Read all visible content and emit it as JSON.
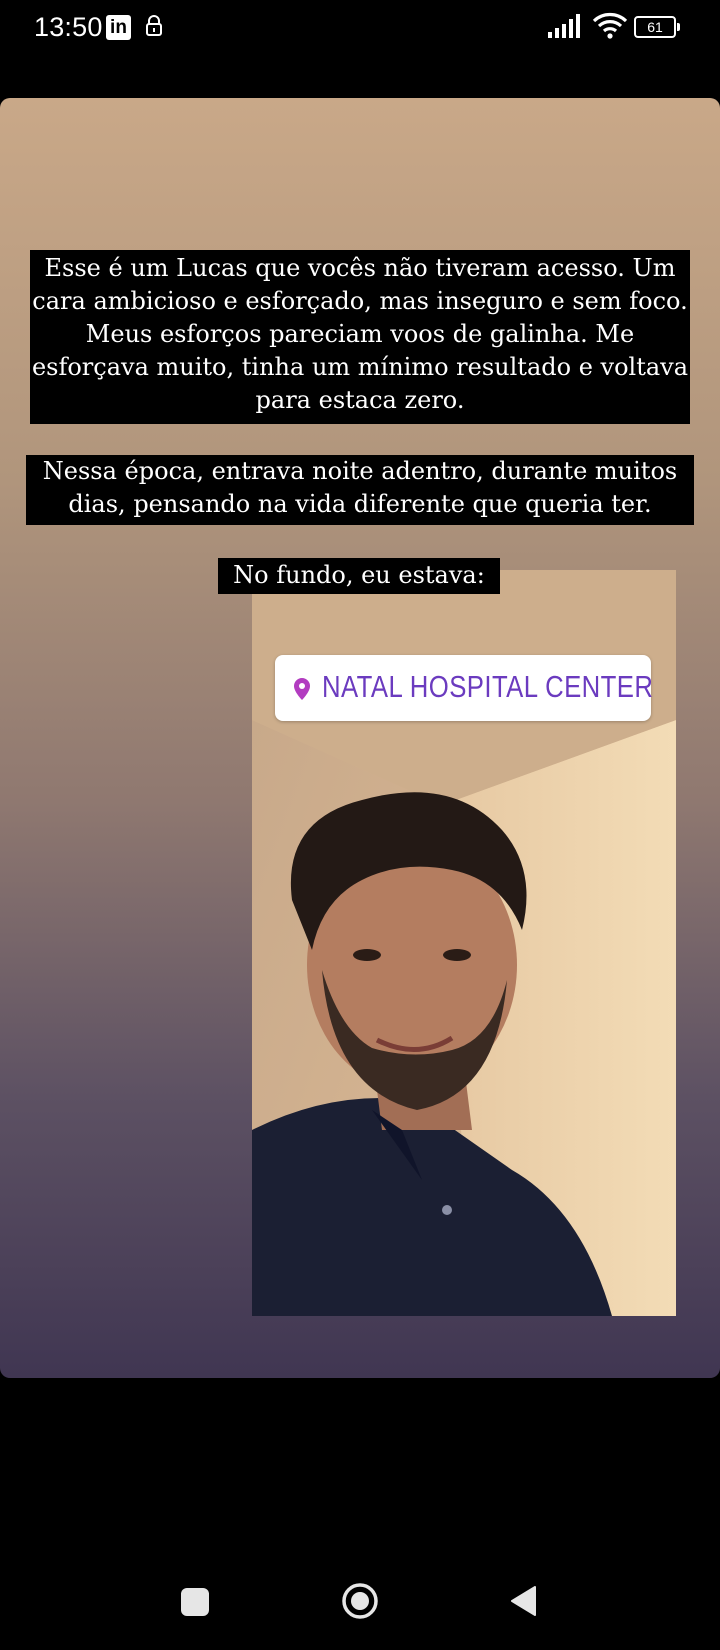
{
  "status_bar": {
    "time": "13:50",
    "app_badge": "in",
    "battery_level": "61"
  },
  "story": {
    "caption_1": "Esse é um Lucas que vocês não tiveram acesso. Um cara ambicioso e esforçado, mas inseguro e sem foco. Meus esforços pareciam voos de galinha. Me esforçava muito, tinha um mínimo resultado e voltava para estaca zero.",
    "caption_2": "Nessa época, entrava noite adentro, durante muitos dias, pensando na vida diferente que queria ter.",
    "caption_3": "No fundo, eu estava:",
    "location_sticker": "NATAL HOSPITAL CENTER"
  },
  "colors": {
    "sticker_text": "#6b3bbf",
    "pin": "#b23cc0"
  },
  "icons": [
    "linkedin-icon",
    "lock-icon",
    "signal-icon",
    "wifi-icon",
    "battery-icon",
    "location-pin-icon",
    "recents-icon",
    "home-icon",
    "back-icon"
  ]
}
